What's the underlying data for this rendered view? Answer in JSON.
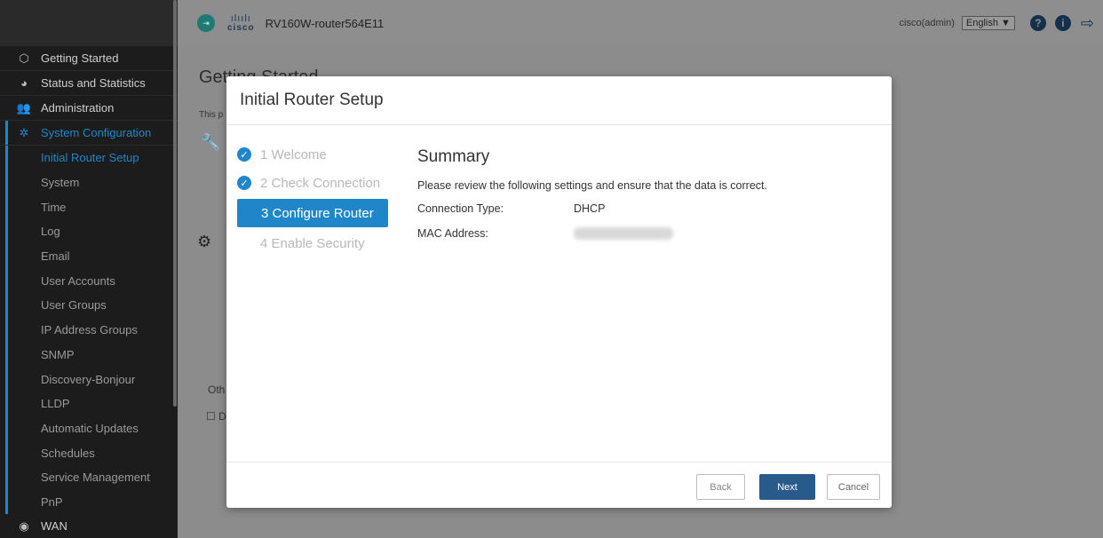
{
  "header": {
    "device_name": "RV160W-router564E11",
    "cisco_word": "cisco",
    "user": "cisco(admin)",
    "language": "English ▼",
    "help_icon": "?",
    "info_icon": "i"
  },
  "sidebar": {
    "items_top": [
      {
        "label": "Getting Started",
        "icon": "getting-started-icon"
      },
      {
        "label": "Status and Statistics",
        "icon": "status-icon"
      },
      {
        "label": "Administration",
        "icon": "administration-icon"
      },
      {
        "label": "System Configuration",
        "icon": "gear-icon"
      }
    ],
    "sub_items": [
      "Initial Router Setup",
      "System",
      "Time",
      "Log",
      "Email",
      "User Accounts",
      "User Groups",
      "IP Address Groups",
      "SNMP",
      "Discovery-Bonjour",
      "LLDP",
      "Automatic Updates",
      "Schedules",
      "Service Management",
      "PnP"
    ],
    "wan": "WAN"
  },
  "background": {
    "title": "Getting Started",
    "this_text": "This p",
    "oth_text": "Oth",
    "cb_text": "☐ D"
  },
  "modal": {
    "title": "Initial Router Setup",
    "steps": [
      "1 Welcome",
      "2 Check Connection",
      "3 Configure Router",
      "4 Enable Security"
    ],
    "summary_title": "Summary",
    "summary_desc": "Please review the following settings and ensure that the data is correct.",
    "connection_type_label": "Connection Type:",
    "connection_type_value": "DHCP",
    "mac_label": "MAC Address:",
    "back": "Back",
    "next": "Next",
    "cancel": "Cancel"
  },
  "colors": {
    "accent": "#1f87c9",
    "next_button": "#285a8c",
    "sidebar_bg": "#1c1c1c"
  }
}
